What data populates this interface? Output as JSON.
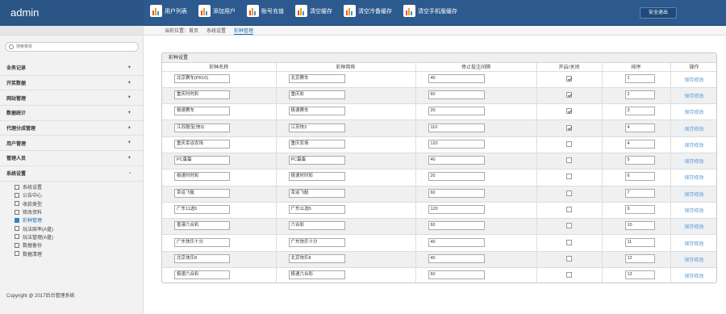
{
  "brand": "admin",
  "top_nav": [
    {
      "label": "用户列表",
      "icon": "bar-chart-icon"
    },
    {
      "label": "添加用户",
      "icon": "bar-chart-icon"
    },
    {
      "label": "账号充值",
      "icon": "bar-chart-icon"
    },
    {
      "label": "清空缓存",
      "icon": "bar-chart-icon"
    },
    {
      "label": "清空冷备缓存",
      "icon": "bar-chart-icon"
    },
    {
      "label": "清空手机版缓存",
      "icon": "bar-chart-icon"
    }
  ],
  "logout_label": "安全退出",
  "search_placeholder": "搜索菜单",
  "menu": [
    {
      "label": "业务记录",
      "sign": "+"
    },
    {
      "label": "开奖数据",
      "sign": "+"
    },
    {
      "label": "网站管理",
      "sign": "+"
    },
    {
      "label": "数据统计",
      "sign": "+"
    },
    {
      "label": "代理分成管理",
      "sign": "+"
    },
    {
      "label": "用户管理",
      "sign": "+"
    },
    {
      "label": "管理人员",
      "sign": "+"
    },
    {
      "label": "系统设置",
      "sign": "-"
    }
  ],
  "submenu": [
    {
      "label": "系统设置",
      "icon": "wrench-icon"
    },
    {
      "label": "公告中心",
      "icon": "document-icon"
    },
    {
      "label": "收款类型",
      "icon": "chat-icon"
    },
    {
      "label": "修改资料",
      "icon": "heart-icon"
    },
    {
      "label": "彩种管理",
      "icon": "grid-icon",
      "active": true
    },
    {
      "label": "玩法赔率(A盘)",
      "icon": "users-icon"
    },
    {
      "label": "玩法管理(A盘)",
      "icon": "users-icon"
    },
    {
      "label": "数据备份",
      "icon": "database-icon"
    },
    {
      "label": "数据清理",
      "icon": "wrench-icon"
    }
  ],
  "copyright": "Copyright @ 2017后台管理系统",
  "breadcrumb": {
    "prefix": "当前位置：首页",
    "parent": "系统设置",
    "current": "彩种管理"
  },
  "panel_title": "彩种设置",
  "table": {
    "headers": [
      "彩种名称",
      "彩种简称",
      "停止投注间隔",
      "开启/关闭",
      "排序",
      "操作"
    ],
    "action_label": "保存修改",
    "rows": [
      {
        "name": "北京赛车(PK10)",
        "short": "北京赛车",
        "interval": "40",
        "enabled": true,
        "order": "1"
      },
      {
        "name": "重庆时时彩",
        "short": "重庆彩",
        "interval": "60",
        "enabled": true,
        "order": "2"
      },
      {
        "name": "极速赛车",
        "short": "极速赛车",
        "interval": "20",
        "enabled": true,
        "order": "3"
      },
      {
        "name": "江苏骰宝(快3)",
        "short": "江苏快3",
        "interval": "110",
        "enabled": true,
        "order": "4"
      },
      {
        "name": "重庆幸运农场",
        "short": "重庆农场",
        "interval": "120",
        "enabled": false,
        "order": "4"
      },
      {
        "name": "PC蛋蛋",
        "short": "PC蛋蛋",
        "interval": "40",
        "enabled": false,
        "order": "5"
      },
      {
        "name": "极速时时彩",
        "short": "极速时时彩",
        "interval": "20",
        "enabled": false,
        "order": "6"
      },
      {
        "name": "幸运飞艇",
        "short": "幸运飞艇",
        "interval": "60",
        "enabled": false,
        "order": "7"
      },
      {
        "name": "广东11选5",
        "short": "广东11选5",
        "interval": "120",
        "enabled": false,
        "order": "9"
      },
      {
        "name": "香港六合彩",
        "short": "六合彩",
        "interval": "60",
        "enabled": false,
        "order": "10"
      },
      {
        "name": "广东快乐十分",
        "short": "广东快乐十分",
        "interval": "40",
        "enabled": false,
        "order": "11"
      },
      {
        "name": "北京快乐8",
        "short": "北京快乐8",
        "interval": "40",
        "enabled": false,
        "order": "12"
      },
      {
        "name": "极速六合彩",
        "short": "极速六合彩",
        "interval": "60",
        "enabled": false,
        "order": "13"
      }
    ]
  }
}
